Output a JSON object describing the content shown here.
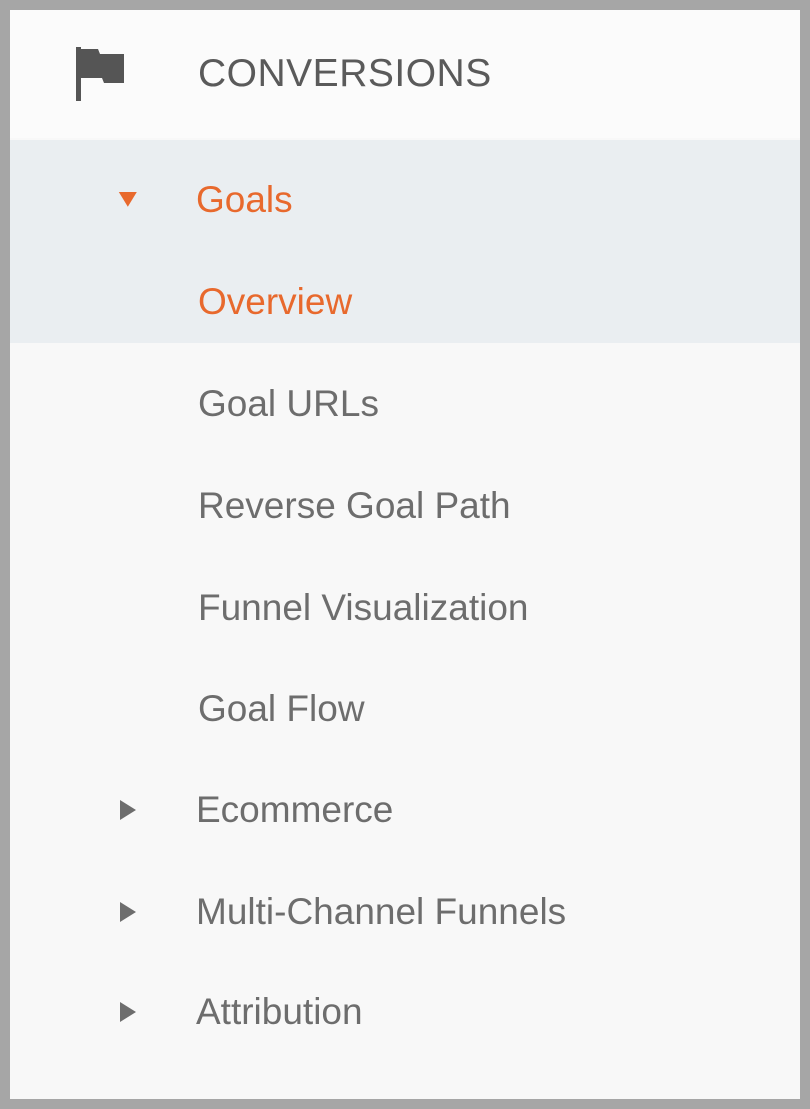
{
  "section": {
    "title": "CONVERSIONS",
    "icon": "flag-icon"
  },
  "colors": {
    "active": "#e8692d",
    "text": "#6d6d6d",
    "highlight_bg": "#eaeef1"
  },
  "nav": {
    "goals": {
      "label": "Goals",
      "icon": "triangle-down-icon"
    },
    "children": [
      {
        "label": "Overview"
      },
      {
        "label": "Goal URLs"
      },
      {
        "label": "Reverse Goal Path"
      },
      {
        "label": "Funnel Visualization"
      },
      {
        "label": "Goal Flow"
      }
    ],
    "collapsed": [
      {
        "label": "Ecommerce",
        "icon": "triangle-right-icon"
      },
      {
        "label": "Multi-Channel Funnels",
        "icon": "triangle-right-icon"
      },
      {
        "label": "Attribution",
        "icon": "triangle-right-icon"
      }
    ]
  }
}
